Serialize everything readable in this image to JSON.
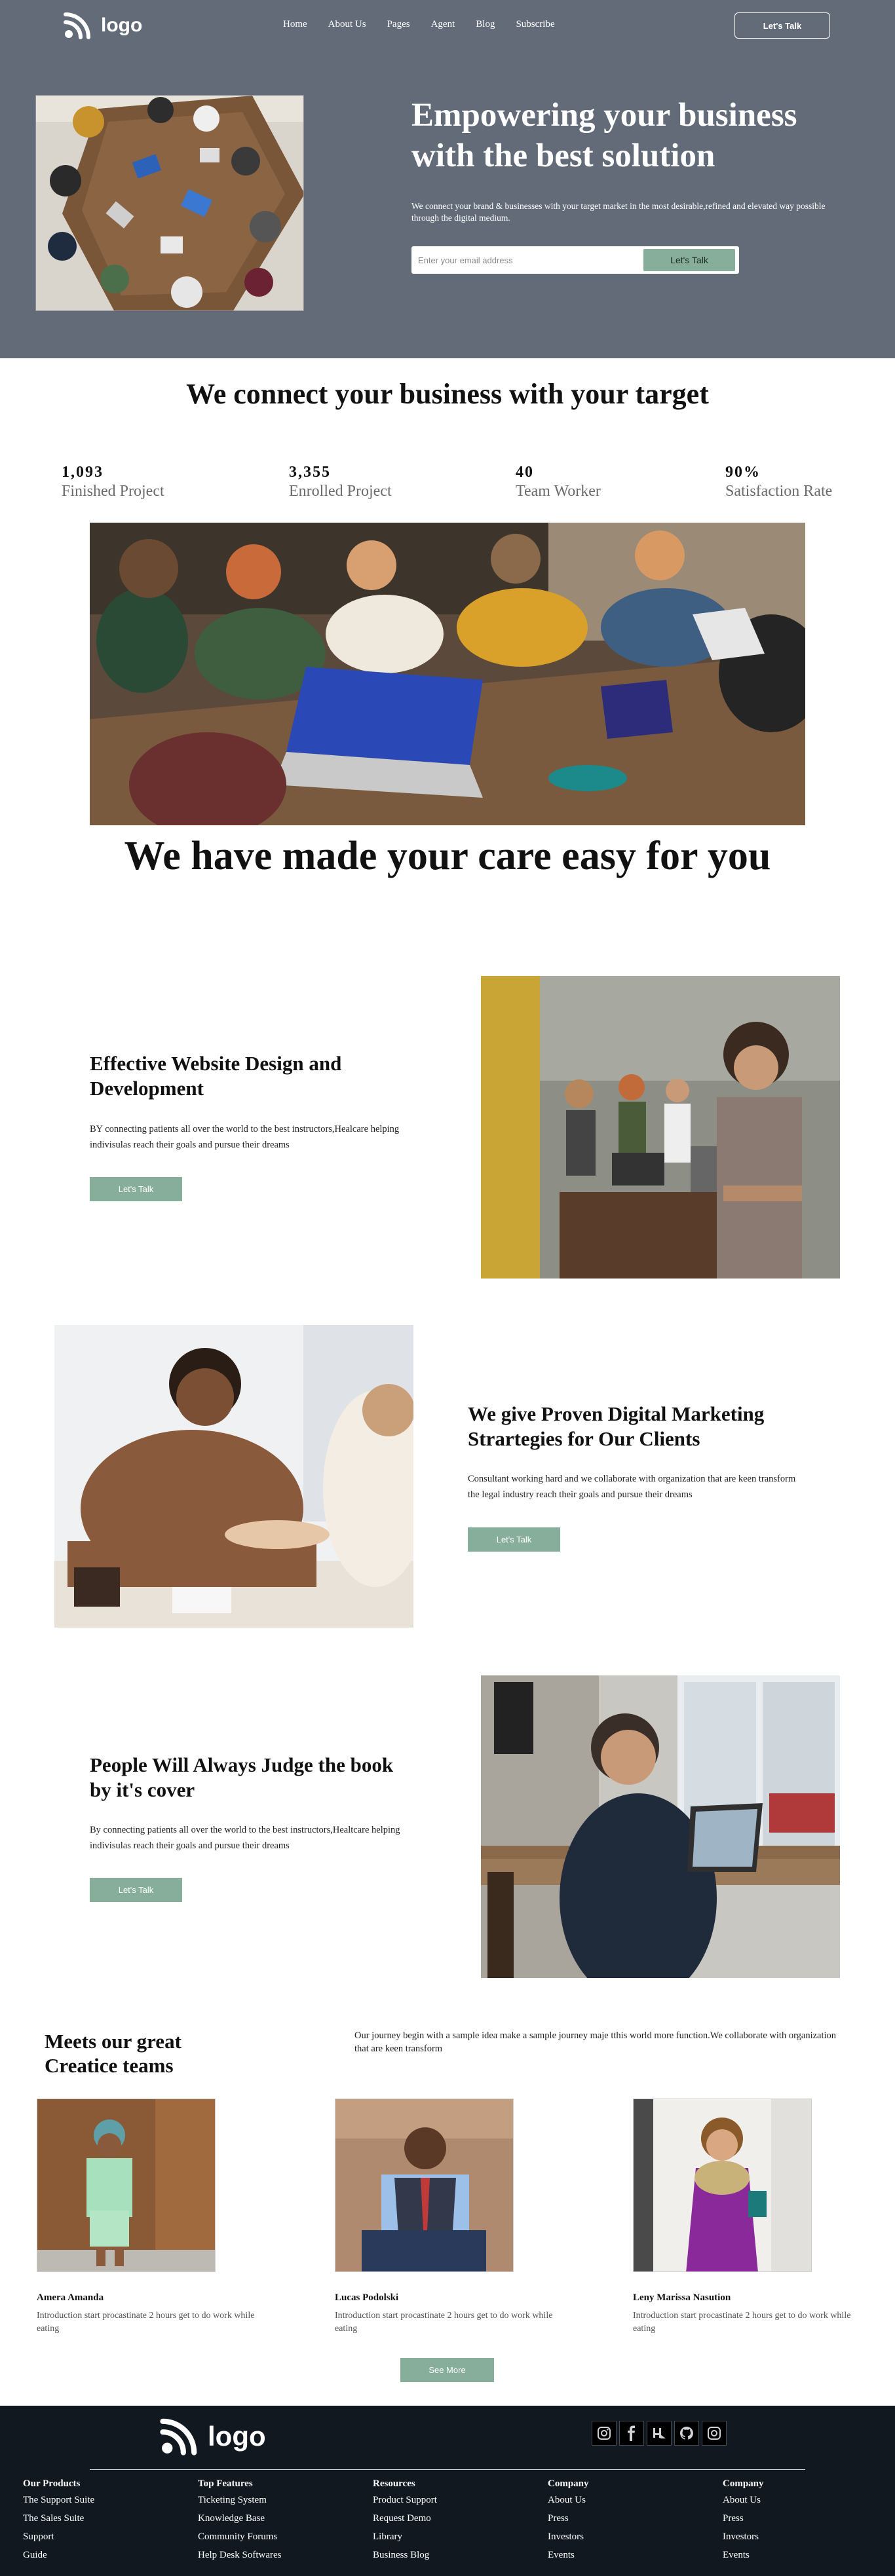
{
  "header": {
    "logo_text": "logo",
    "nav": [
      "Home",
      "About Us",
      "Pages",
      "Agent",
      "Blog",
      "Subscribe"
    ],
    "cta_label": "Let's Talk"
  },
  "hero": {
    "title": "Empowering your business with the best solution",
    "subtitle": "We connect your brand & businesses with your target market in the most desirable,refined and elevated way possible through the digital medium.",
    "email_placeholder": "Enter your email address",
    "button_label": "Let's Talk"
  },
  "connect": {
    "title": "We connect your business with your target",
    "stats": [
      {
        "value": "1,093",
        "label": "Finished Project"
      },
      {
        "value": "3,355",
        "label": "Enrolled Project"
      },
      {
        "value": "40",
        "label": "Team Worker"
      },
      {
        "value": "90%",
        "label": "Satisfaction Rate"
      }
    ]
  },
  "care": {
    "title": "We have made your care easy for you"
  },
  "features": [
    {
      "title": "Effective Website Design and Development",
      "desc": "BY connecting patients all over the world to the best instructors,Healcare helping indivisulas reach their goals and pursue their dreams",
      "button": "Let's Talk"
    },
    {
      "title": "We give Proven Digital Marketing Strartegies for Our Clients",
      "desc": "Consultant working hard and we collaborate with organization that are keen transform the legal industry reach their goals and pursue their dreams",
      "button": "Let's Talk"
    },
    {
      "title": "People Will Always Judge the book by it's cover",
      "desc": "By connecting patients all over the world to the best instructors,Healtcare helping indivisulas reach their goals and pursue their dreams",
      "button": "Let's Talk"
    }
  ],
  "team": {
    "heading": "Meets our great Creatice teams",
    "intro": "Our journey begin with a sample idea make a sample journey maje tthis world more function.We collaborate with organization that are keen transform",
    "members": [
      {
        "name": "Amera Amanda",
        "desc": "Introduction start procastinate 2 hours get to do work while eating"
      },
      {
        "name": "Lucas Podolski",
        "desc": "Introduction start procastinate 2 hours get to do work while eating"
      },
      {
        "name": "Leny Marissa Nasution",
        "desc": "Introduction start procastinate 2 hours get to do work while eating"
      }
    ],
    "see_more": "See More"
  },
  "footer": {
    "logo_text": "logo",
    "social_icons": [
      "instagram-icon",
      "facebook-icon",
      "twitter-icon",
      "github-icon",
      "camera-icon"
    ],
    "columns": [
      {
        "title": "Our Products",
        "items": [
          "The Support Suite",
          "The Sales Suite",
          "Support",
          "Guide"
        ]
      },
      {
        "title": "Top Features",
        "items": [
          "Ticketing System",
          "Knowledge Base",
          "Community Forums",
          "Help Desk Softwares"
        ]
      },
      {
        "title": "Resources",
        "items": [
          "Product Support",
          "Request Demo",
          "Library",
          "Business Blog"
        ]
      },
      {
        "title": "Company",
        "items": [
          "About Us",
          "Press",
          "Investors",
          "Events"
        ]
      },
      {
        "title": "Company",
        "items": [
          "About Us",
          "Press",
          "Investors",
          "Events"
        ]
      }
    ]
  },
  "colors": {
    "hero_bg": "#636b78",
    "accent_green": "#86ae9a",
    "footer_bg": "#111820"
  }
}
